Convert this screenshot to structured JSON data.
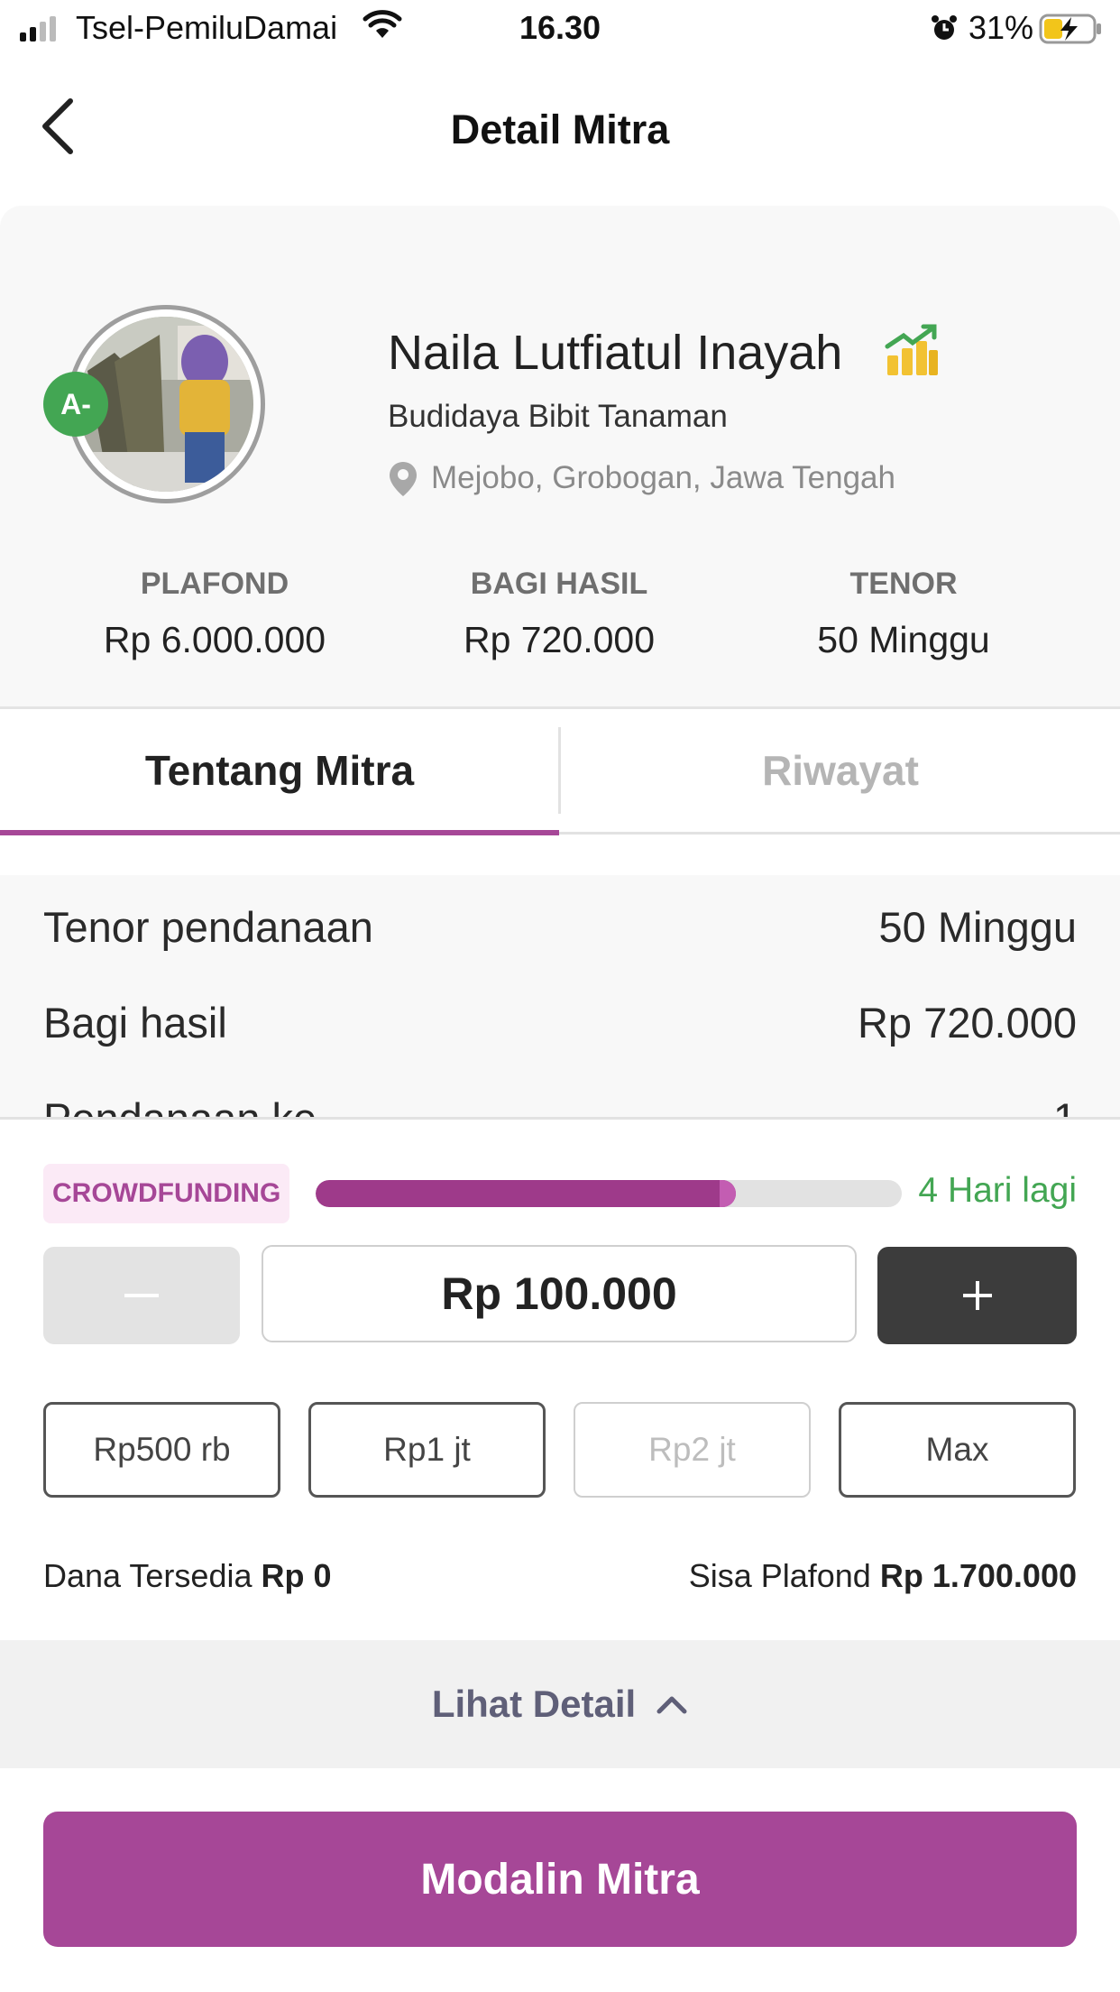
{
  "status_bar": {
    "carrier": "Tsel-PemiluDamai",
    "time": "16.30",
    "battery": "31%",
    "icons": [
      "signal-icon",
      "wifi-icon",
      "alarm-icon",
      "battery-charging-icon"
    ]
  },
  "header": {
    "title": "Detail Mitra",
    "back_icon": "chevron-left-icon"
  },
  "profile": {
    "grade": "A-",
    "name": "Naila Lutfiatul Inayah",
    "sector": "Budidaya Bibit Tanaman",
    "location": "Mejobo, Grobogan, Jawa Tengah",
    "growth_icon": "chart-growth-icon",
    "location_icon": "location-pin-icon"
  },
  "stats": [
    {
      "label": "PLAFOND",
      "value": "Rp 6.000.000"
    },
    {
      "label": "BAGI HASIL",
      "value": "Rp 720.000"
    },
    {
      "label": "TENOR",
      "value": "50 Minggu"
    }
  ],
  "tabs": [
    {
      "label": "Tentang Mitra",
      "active": true
    },
    {
      "label": "Riwayat",
      "active": false
    }
  ],
  "details": [
    {
      "label": "Tenor pendanaan",
      "value": "50 Minggu"
    },
    {
      "label": "Bagi hasil",
      "value": "Rp 720.000"
    },
    {
      "label": "Pendanaan ke",
      "value": "1"
    }
  ],
  "funding": {
    "badge": "CROWDFUNDING",
    "progress_fraction": 0.717,
    "days_left": "4 Hari lagi",
    "amount": "Rp 100.000",
    "presets": [
      {
        "label": "Rp500 rb",
        "enabled": true
      },
      {
        "label": "Rp1 jt",
        "enabled": true
      },
      {
        "label": "Rp2 jt",
        "enabled": false
      },
      {
        "label": "Max",
        "enabled": true
      }
    ],
    "available_label": "Dana Tersedia",
    "available_value": "Rp 0",
    "sisa_label": "Sisa Plafond",
    "sisa_value": "Rp 1.700.000"
  },
  "detail_toggle": {
    "label": "Lihat Detail",
    "icon": "chevron-up-icon"
  },
  "cta": {
    "label": "Modalin Mitra"
  },
  "colors": {
    "brand": "#a64797",
    "success": "#43a653",
    "dark_button": "#3c3c3c"
  }
}
